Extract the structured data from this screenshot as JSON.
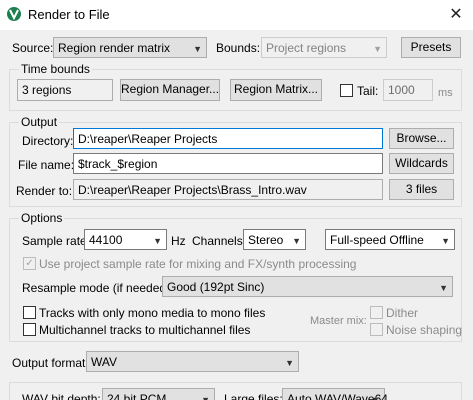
{
  "window": {
    "title": "Render to File",
    "close_glyph": "✕"
  },
  "source": {
    "label": "Source:",
    "value": "Region render matrix"
  },
  "bounds": {
    "label": "Bounds:",
    "value": "Project regions"
  },
  "presets_label": "Presets",
  "time_bounds": {
    "title": "Time bounds",
    "regions_value": "3 regions",
    "region_manager_label": "Region Manager...",
    "region_matrix_label": "Region Matrix...",
    "tail_label": "Tail:",
    "tail_value": "1000",
    "tail_unit": "ms"
  },
  "output": {
    "title": "Output",
    "directory_label": "Directory:",
    "directory_value": "D:\\reaper\\Reaper Projects",
    "browse_label": "Browse...",
    "filename_label": "File name:",
    "filename_value": "$track_$region",
    "wildcards_label": "Wildcards",
    "render_to_label": "Render to:",
    "render_to_value": "D:\\reaper\\Reaper Projects\\Brass_Intro.wav",
    "files_count_label": "3 files"
  },
  "options": {
    "title": "Options",
    "sample_rate_label": "Sample rate:",
    "sample_rate_value": "44100",
    "hz_label": "Hz",
    "channels_label": "Channels:",
    "channels_value": "Stereo",
    "render_speed_value": "Full-speed Offline",
    "use_project_rate_label": "Use project sample rate for mixing and FX/synth processing",
    "resample_label": "Resample mode (if needed):",
    "resample_value": "Good (192pt Sinc)",
    "mono_tracks_label": "Tracks with only mono media to mono files",
    "multichannel_label": "Multichannel tracks to multichannel files",
    "master_mix_label": "Master mix:",
    "dither_label": "Dither",
    "noise_shaping_label": "Noise shaping"
  },
  "output_format": {
    "label": "Output format:",
    "value": "WAV"
  },
  "wav": {
    "bit_depth_label": "WAV bit depth:",
    "bit_depth_value": "24 bit PCM",
    "large_files_label": "Large files:",
    "large_files_value": "Auto WAV/Wave64"
  }
}
